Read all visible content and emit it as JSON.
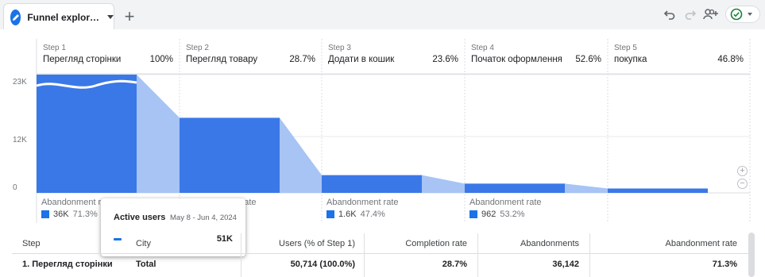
{
  "tab": {
    "label": "Funnel explor…"
  },
  "add_tab_label": "+",
  "colors": {
    "accent": "#1a73e8",
    "bar": "#3b78e7",
    "bar_light": "#a7c4f5",
    "success": "#188038"
  },
  "toolbar": {
    "icons": [
      "undo-icon",
      "redo-icon",
      "share-users-icon",
      "status-check-icon"
    ]
  },
  "steps": [
    {
      "num": "Step 1",
      "name": "Перегляд сторінки",
      "pct": "100%"
    },
    {
      "num": "Step 2",
      "name": "Перегляд товару",
      "pct": "28.7%"
    },
    {
      "num": "Step 3",
      "name": "Додати в кошик",
      "pct": "23.6%"
    },
    {
      "num": "Step 4",
      "name": "Початок оформлення",
      "pct": "52.6%"
    },
    {
      "num": "Step 5",
      "name": "покупка",
      "pct": "46.8%"
    }
  ],
  "y_axis": [
    "23K",
    "12K",
    "0"
  ],
  "abandonment": [
    {
      "title": "Abandonment rate",
      "value": "36K",
      "pct": "71.3%"
    },
    {
      "title": "Abandonment rate",
      "value": "",
      "pct": ""
    },
    {
      "title": "Abandonment rate",
      "value": "1.6K",
      "pct": "47.4%"
    },
    {
      "title": "Abandonment rate",
      "value": "962",
      "pct": "53.2%"
    }
  ],
  "tooltip": {
    "title": "Active users",
    "date": "May 8 - Jun 4, 2024",
    "value": "51K"
  },
  "chart_data": {
    "type": "bar",
    "categories": [
      "Перегляд сторінки",
      "Перегляд товару",
      "Додати в кошик",
      "Початок оформлення",
      "покупка"
    ],
    "values": [
      23000,
      14600,
      3450,
      1800,
      850
    ],
    "ylim": [
      0,
      23000
    ],
    "completion_pct": [
      "100%",
      "28.7%",
      "23.6%",
      "52.6%",
      "46.8%"
    ]
  },
  "table": {
    "headers": [
      "Step",
      "City",
      "Users (% of Step 1)",
      "Completion rate",
      "Abandonments",
      "Abandonment rate"
    ],
    "rows": [
      [
        "1. Перегляд сторінки",
        "Total",
        "50,714 (100.0%)",
        "28.7%",
        "36,142",
        "71.3%"
      ]
    ]
  }
}
